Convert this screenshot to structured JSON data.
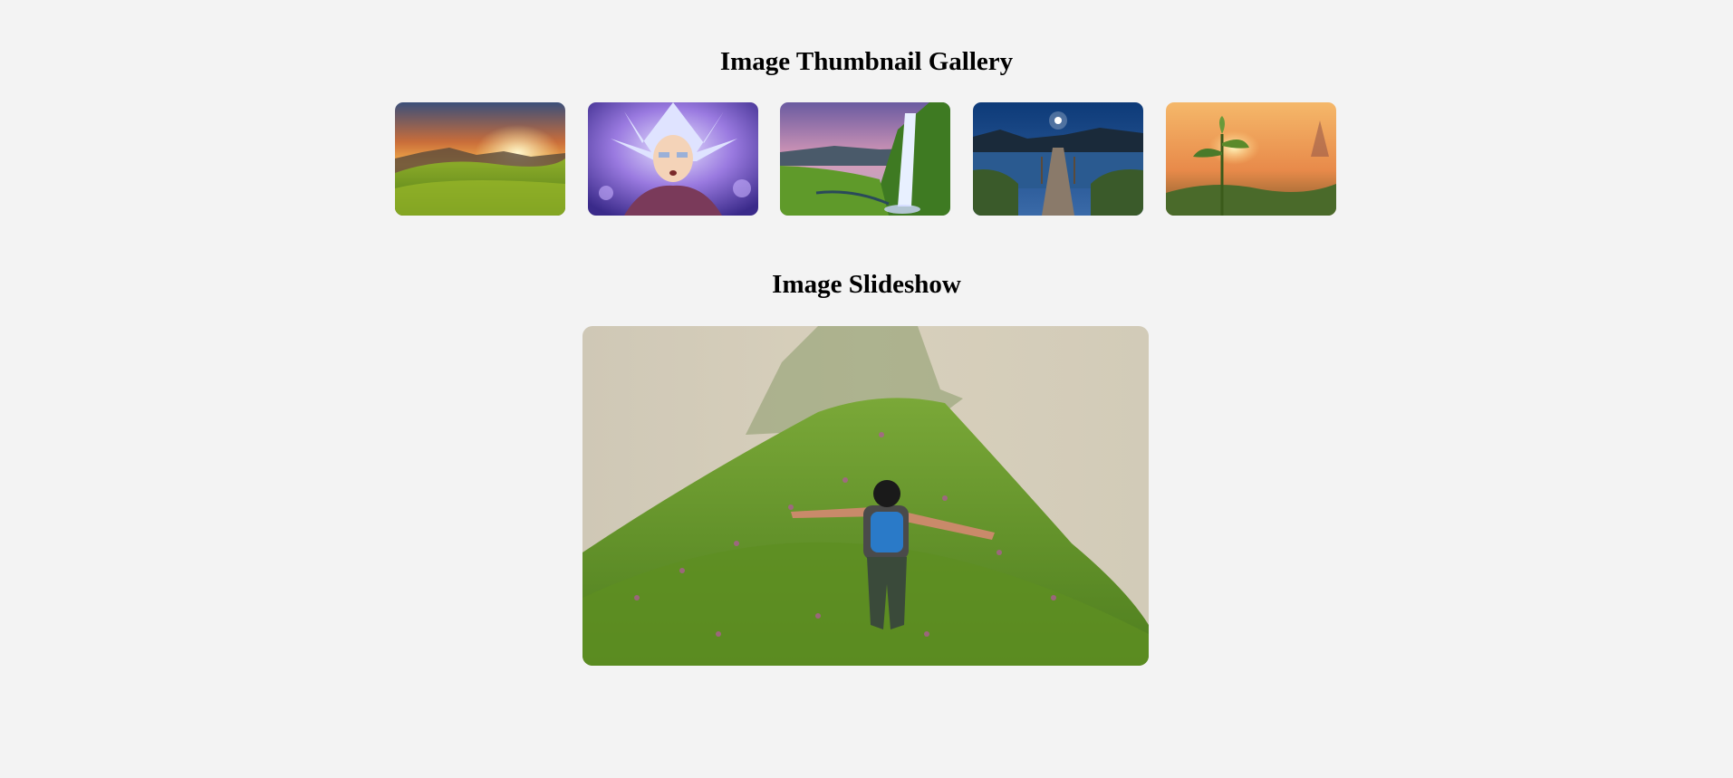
{
  "gallery": {
    "title": "Image Thumbnail Gallery",
    "thumbnails": [
      {
        "icon": "sunset-meadow-image"
      },
      {
        "icon": "anime-character-image"
      },
      {
        "icon": "waterfall-image"
      },
      {
        "icon": "lake-pier-night-image"
      },
      {
        "icon": "sunset-plant-image"
      }
    ]
  },
  "slideshow": {
    "title": "Image Slideshow",
    "current_image": "hiker-on-grassy-ridge-image"
  }
}
